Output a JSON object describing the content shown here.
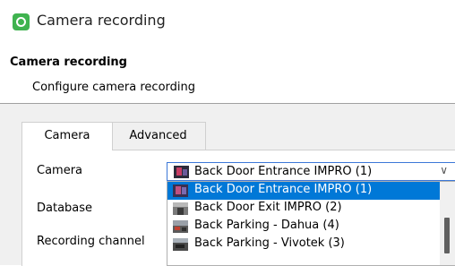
{
  "window": {
    "title": "Camera recording",
    "icon": "camera-app-icon",
    "accent_color": "#3fb34f"
  },
  "header": {
    "title": "Camera recording",
    "subtitle": "Configure camera recording"
  },
  "tabs": [
    {
      "label": "Camera",
      "active": true
    },
    {
      "label": "Advanced",
      "active": false
    }
  ],
  "form": {
    "camera_label": "Camera",
    "database_label": "Database",
    "recording_channel_label": "Recording channel",
    "camera_value": "Back Door Entrance IMPRO (1)",
    "camera_icon": "camera-thumbnail-icon"
  },
  "dropdown": {
    "selected_index": 0,
    "selection_color": "#0078d7",
    "options": [
      {
        "label": "Back Door Entrance IMPRO (1)",
        "icon": "camera-thumbnail-icon"
      },
      {
        "label": "Back Door Exit IMPRO (2)",
        "icon": "camera-thumbnail-icon"
      },
      {
        "label": "Back Parking - Dahua (4)",
        "icon": "camera-thumbnail-icon"
      },
      {
        "label": "Back Parking - Vivotek (3)",
        "icon": "camera-thumbnail-icon"
      }
    ]
  }
}
